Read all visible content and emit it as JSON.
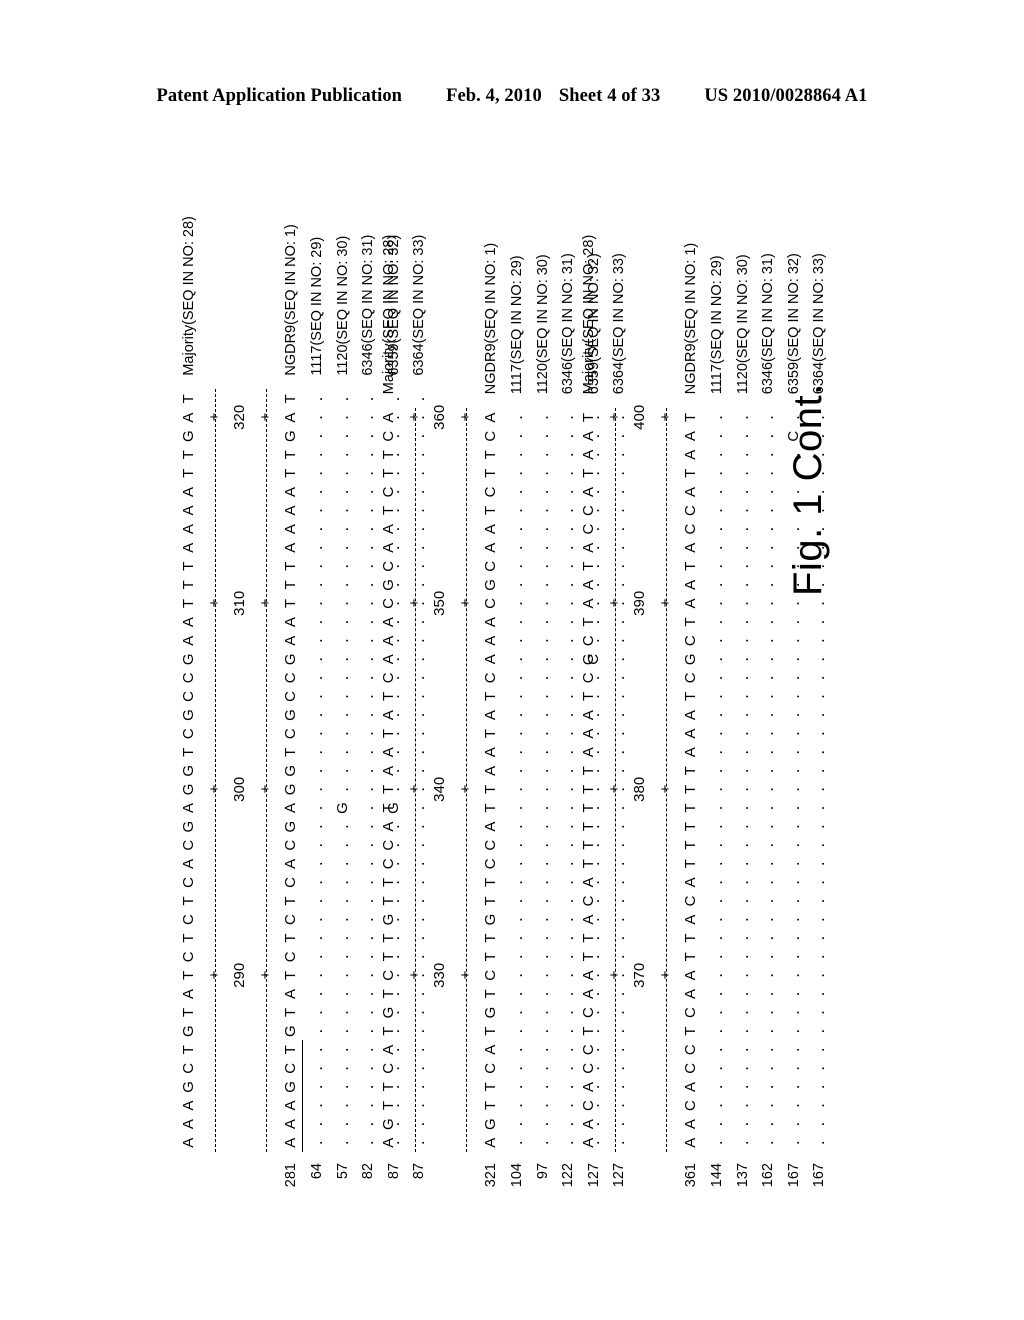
{
  "header": {
    "publication": "Patent Application Publication",
    "date": "Feb. 4, 2010",
    "sheet": "Sheet 4 of 33",
    "patent_number": "US 2010/0028864 A1"
  },
  "figure": {
    "caption": "Fig. 1 Cont."
  },
  "alignment": {
    "char_count": 40,
    "blocks": [
      {
        "id": "block-1",
        "majority": {
          "row_number": "",
          "sequence": "AAAGCTGTATCTCTCACGAGGTCGCCGAATTTAAAATTGAT",
          "label": "Majority(SEQ IN NO: 28)"
        },
        "ruler": {
          "ticks": [
            {
              "index": 9,
              "label": "290"
            },
            {
              "index": 19,
              "label": "300"
            },
            {
              "index": 29,
              "label": "310"
            },
            {
              "index": 39,
              "label": "320"
            }
          ]
        },
        "rows": [
          {
            "row_number": "281",
            "sequence": "AAAGCTGTATCTCTCACGAGGTCGCCGAATTTAAAATTGAT",
            "underline_start": 0,
            "underline_end": 6,
            "label": "NGDR9(SEQ IN NO: 1)"
          },
          {
            "row_number": "64",
            "sequence": ".........................................",
            "label": "1117(SEQ IN NO: 29)"
          },
          {
            "row_number": "57",
            "sequence": "..................G......................",
            "label": "1120(SEQ IN NO: 30)"
          },
          {
            "row_number": "82",
            "sequence": ".........................................",
            "label": "6346(SEQ IN NO: 31)"
          },
          {
            "row_number": "87",
            "sequence": "..................G......................",
            "label": "6359(SEQ IN NO: 32)"
          },
          {
            "row_number": "87",
            "sequence": ".........................................",
            "label": "6364(SEQ IN NO: 33)"
          }
        ]
      },
      {
        "id": "block-2",
        "majority": {
          "row_number": "",
          "sequence": "AGTTCATGTCTTGTTCCATTAATATCAAACGCAATCTTCA",
          "label": "Majority(SEQ IN NO: 28)"
        },
        "ruler": {
          "ticks": [
            {
              "index": 9,
              "label": "330"
            },
            {
              "index": 19,
              "label": "340"
            },
            {
              "index": 29,
              "label": "350"
            },
            {
              "index": 39,
              "label": "360"
            }
          ]
        },
        "rows": [
          {
            "row_number": "321",
            "sequence": "AGTTCATGTCTTGTTCCATTAATATCAAACGCAATCTTCA",
            "label": "NGDR9(SEQ IN NO: 1)"
          },
          {
            "row_number": "104",
            "sequence": "........................................",
            "label": "1117(SEQ IN NO: 29)"
          },
          {
            "row_number": "97",
            "sequence": "........................................",
            "label": "1120(SEQ IN NO: 30)"
          },
          {
            "row_number": "122",
            "sequence": "........................................",
            "label": "6346(SEQ IN NO: 31)"
          },
          {
            "row_number": "127",
            "sequence": "..........................C.............",
            "label": "6359(SEQ IN NO: 32)"
          },
          {
            "row_number": "127",
            "sequence": "........................................",
            "label": "6364(SEQ IN NO: 33)"
          }
        ]
      },
      {
        "id": "block-3",
        "majority": {
          "row_number": "",
          "sequence": "AACACCTCAATTACATTTTTTAAATCGCTAATACCATAAT",
          "label": "Majority(SEQ IN NO: 28)"
        },
        "ruler": {
          "ticks": [
            {
              "index": 9,
              "label": "370"
            },
            {
              "index": 19,
              "label": "380"
            },
            {
              "index": 29,
              "label": "390"
            },
            {
              "index": 39,
              "label": "400"
            }
          ]
        },
        "rows": [
          {
            "row_number": "361",
            "sequence": "AACACCTCAATTACATTTTTTAAATCGCTAATACCATAAT",
            "label": "NGDR9(SEQ IN NO: 1)"
          },
          {
            "row_number": "144",
            "sequence": "........................................",
            "label": "1117(SEQ IN NO: 29)"
          },
          {
            "row_number": "137",
            "sequence": "........................................",
            "label": "1120(SEQ IN NO: 30)"
          },
          {
            "row_number": "162",
            "sequence": "........................................",
            "label": "6346(SEQ IN NO: 31)"
          },
          {
            "row_number": "167",
            "sequence": "......................................C.",
            "label": "6359(SEQ IN NO: 32)"
          },
          {
            "row_number": "167",
            "sequence": "........................................",
            "label": "6364(SEQ IN NO: 33)"
          }
        ]
      }
    ]
  }
}
